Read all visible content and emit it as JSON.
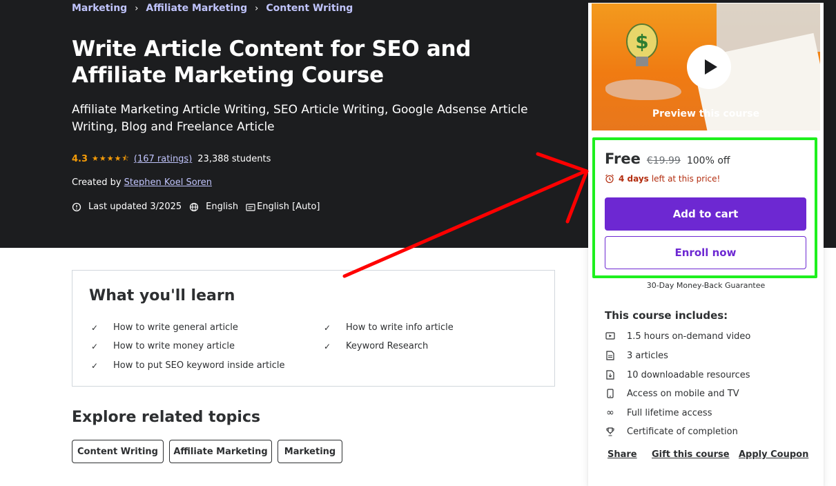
{
  "breadcrumb": [
    "Marketing",
    "Affiliate Marketing",
    "Content Writing"
  ],
  "course": {
    "title": "Write Article Content for SEO and Affiliate Marketing Course",
    "subtitle": "Affiliate Marketing Article Writing, SEO Article Writing, Google Adsense Article Writing, Blog and Freelance Article",
    "rating": "4.3",
    "rating_value": 4.3,
    "ratings_link": "(167 ratings)",
    "students": "23,388 students",
    "created_by_label": "Created by",
    "author": "Stephen Koel Soren",
    "last_updated": "Last updated 3/2025",
    "language": "English",
    "captions": "English [Auto]"
  },
  "learn": {
    "title": "What you'll learn",
    "items": [
      "How to write general article",
      "How to write info article",
      "How to write money article",
      "Keyword Research",
      "How to put SEO keyword inside article"
    ]
  },
  "explore": {
    "title": "Explore related topics",
    "topics": [
      "Content Writing",
      "Affiliate Marketing",
      "Marketing"
    ]
  },
  "sidebar": {
    "preview_label": "Preview this course",
    "price": "Free",
    "original_price": "€19.99",
    "discount": "100% off",
    "timer_days": "4 days",
    "timer_text": "left at this price!",
    "add_to_cart": "Add to cart",
    "enroll_now": "Enroll now",
    "guarantee": "30-Day Money-Back Guarantee",
    "includes_title": "This course includes:",
    "includes": [
      {
        "icon": "video-icon",
        "label": "1.5 hours on-demand video"
      },
      {
        "icon": "article-icon",
        "label": "3 articles"
      },
      {
        "icon": "download-icon",
        "label": "10 downloadable resources"
      },
      {
        "icon": "mobile-icon",
        "label": "Access on mobile and TV"
      },
      {
        "icon": "infinity-icon",
        "label": "Full lifetime access"
      },
      {
        "icon": "trophy-icon",
        "label": "Certificate of completion"
      }
    ],
    "links": [
      "Share",
      "Gift this course",
      "Apply Coupon"
    ]
  },
  "colors": {
    "hero_bg": "#1c1d1f",
    "link_purple": "#c0c4fc",
    "star": "#f69c08",
    "primary": "#6d28d2",
    "timer_red": "#b32d0f",
    "highlight_green": "#1ef01e",
    "annotation_red": "#ff0000"
  }
}
